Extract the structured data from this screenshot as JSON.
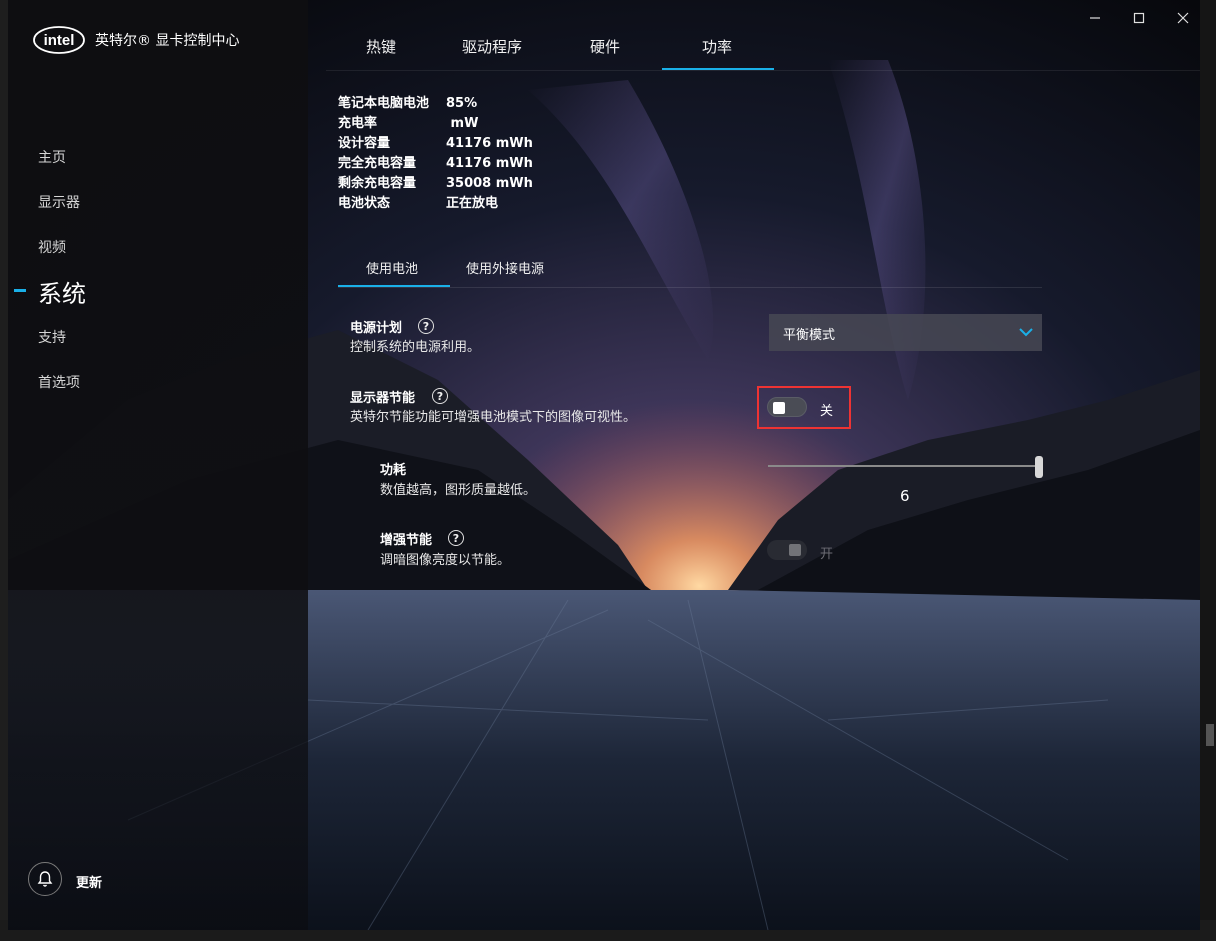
{
  "app": {
    "title": "英特尔® 显卡控制中心",
    "logo_text": "intel"
  },
  "sidebar": {
    "items": [
      {
        "label": "主页"
      },
      {
        "label": "显示器"
      },
      {
        "label": "视频"
      },
      {
        "label": "系统"
      },
      {
        "label": "支持"
      },
      {
        "label": "首选项"
      }
    ],
    "active_index": 3,
    "update_label": "更新"
  },
  "top_tabs": [
    {
      "label": "热键"
    },
    {
      "label": "驱动程序"
    },
    {
      "label": "硬件"
    },
    {
      "label": "功率"
    }
  ],
  "battery": [
    {
      "label": "笔记本电脑电池",
      "value": "85%"
    },
    {
      "label": "充电率",
      "value": " mW"
    },
    {
      "label": "设计容量",
      "value": "41176 mWh"
    },
    {
      "label": "完全充电容量",
      "value": "41176 mWh"
    },
    {
      "label": "剩余充电容量",
      "value": "35008 mWh"
    },
    {
      "label": "电池状态",
      "value": "正在放电"
    }
  ],
  "sub_tabs": [
    {
      "label": "使用电池"
    },
    {
      "label": "使用外接电源"
    }
  ],
  "settings": {
    "power_plan": {
      "title": "电源计划",
      "desc": "控制系统的电源利用。",
      "value": "平衡模式"
    },
    "display_saving": {
      "title": "显示器节能",
      "desc": "英特尔节能功能可增强电池模式下的图像可视性。",
      "state": "关"
    },
    "power": {
      "title": "功耗",
      "desc": "数值越高，图形质量越低。",
      "value": "6"
    },
    "enhanced_saving": {
      "title": "增强节能",
      "desc": "调暗图像亮度以节能。",
      "state": "开"
    }
  },
  "help_glyph": "?",
  "colors": {
    "accent": "#1ab0e8",
    "highlight": "#e33333"
  },
  "icons": {
    "update": "bell-icon",
    "dropdown": "chevron-down-icon",
    "help": "question-circle-icon"
  }
}
